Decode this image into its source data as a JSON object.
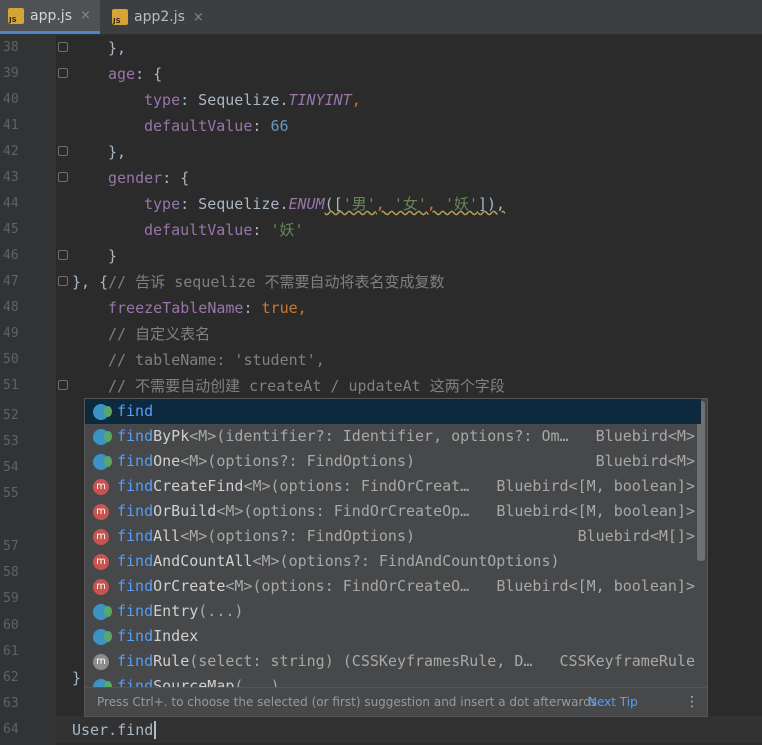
{
  "tabs": [
    {
      "label": "app.js",
      "close": "×",
      "icon": "js-file-icon",
      "badge": "JS"
    },
    {
      "label": "app2.js",
      "close": "×",
      "icon": "js-file-icon",
      "badge": "JS"
    }
  ],
  "lines": [
    {
      "num": "38"
    },
    {
      "num": "39"
    },
    {
      "num": "40"
    },
    {
      "num": "41"
    },
    {
      "num": "42"
    },
    {
      "num": "43"
    },
    {
      "num": "44"
    },
    {
      "num": "45"
    },
    {
      "num": "46"
    },
    {
      "num": "47"
    },
    {
      "num": "48"
    },
    {
      "num": "49"
    },
    {
      "num": "50"
    },
    {
      "num": "51"
    },
    {
      "num": "52"
    },
    {
      "num": "53"
    },
    {
      "num": "54"
    },
    {
      "num": "55"
    },
    {
      "num": "57"
    },
    {
      "num": "58"
    },
    {
      "num": "59"
    },
    {
      "num": "60"
    },
    {
      "num": "61"
    },
    {
      "num": "62"
    },
    {
      "num": "63"
    },
    {
      "num": "64"
    }
  ],
  "code": {
    "l38": "},",
    "l39_key": "age",
    "l39_rest": ": {",
    "l40_key": "type",
    "l40_a": ": Sequelize.",
    "l40_b": "TINYINT",
    "l40_c": ",",
    "l41_key": "defaultValue",
    "l41_a": ": ",
    "l41_b": "66",
    "l42": "},",
    "l43_key": "gender",
    "l43_rest": ": {",
    "l44_key": "type",
    "l44_a": ": Sequelize.",
    "l44_b": "ENUM",
    "l44_c": "([",
    "l44_s1": "'男'",
    "l44_s2": "'女'",
    "l44_s3": "'妖'",
    "l44_d": "]),",
    "l45_key": "defaultValue",
    "l45_a": ": ",
    "l45_b": "'妖'",
    "l46": "}",
    "l47_a": "}, {",
    "l47_c": "// 告诉 sequelize 不需要自动将表名变成复数",
    "l48_key": "freezeTableName",
    "l48_a": ": ",
    "l48_b": "true",
    "l48_c": ",",
    "l49": "// 自定义表名",
    "l50": "// tableName: 'student',",
    "l51": "// 不需要自动创建 createAt / updateAt 这两个字段",
    "l62": "}",
    "l64_a": "User.",
    "l64_b": "find"
  },
  "popup": {
    "items": [
      {
        "icon": "function-icon",
        "hl": "find",
        "rest": "",
        "sig": "",
        "type": ""
      },
      {
        "icon": "function-icon",
        "hl": "find",
        "rest": "ByPk",
        "sig": "<M>(identifier?: Identifier, options?: Om…",
        "type": "Bluebird<M>"
      },
      {
        "icon": "function-icon",
        "hl": "find",
        "rest": "One",
        "sig": "<M>(options?: FindOptions)",
        "type": "Bluebird<M>"
      },
      {
        "icon": "method-icon",
        "hl": "find",
        "rest": "CreateFind",
        "sig": "<M>(options: FindOrCreat…",
        "type": "Bluebird<[M, boolean]>"
      },
      {
        "icon": "method-icon",
        "hl": "find",
        "rest": "OrBuild",
        "sig": "<M>(options: FindOrCreateOp…",
        "type": "Bluebird<[M, boolean]>"
      },
      {
        "icon": "method-icon",
        "hl": "find",
        "rest": "All",
        "sig": "<M>(options?: FindOptions)",
        "type": "Bluebird<M[]>"
      },
      {
        "icon": "method-icon",
        "hl": "find",
        "rest": "AndCountAll",
        "sig": "<M>(options?: FindAndCountOptions)",
        "type": ""
      },
      {
        "icon": "method-icon",
        "hl": "find",
        "rest": "OrCreate",
        "sig": "<M>(options: FindOrCreateO…",
        "type": "Bluebird<[M, boolean]>"
      },
      {
        "icon": "function-icon",
        "hl": "find",
        "rest": "Entry",
        "sig": "(...)",
        "type": ""
      },
      {
        "icon": "function-icon",
        "hl": "find",
        "rest": "Index",
        "sig": "",
        "type": ""
      },
      {
        "icon": "method-gray-icon",
        "hl": "find",
        "rest": "Rule",
        "sig": "(select: string) (CSSKeyframesRule, D…",
        "type": "CSSKeyframeRule"
      },
      {
        "icon": "function-icon",
        "hl": "find",
        "rest": "SourceMap",
        "sig": "(...)",
        "type": ""
      }
    ],
    "method_badge": "m",
    "hint": "Press Ctrl+. to choose the selected (or first) suggestion and insert a dot afterwards",
    "next_tip": "Next Tip",
    "more": "⋮"
  }
}
